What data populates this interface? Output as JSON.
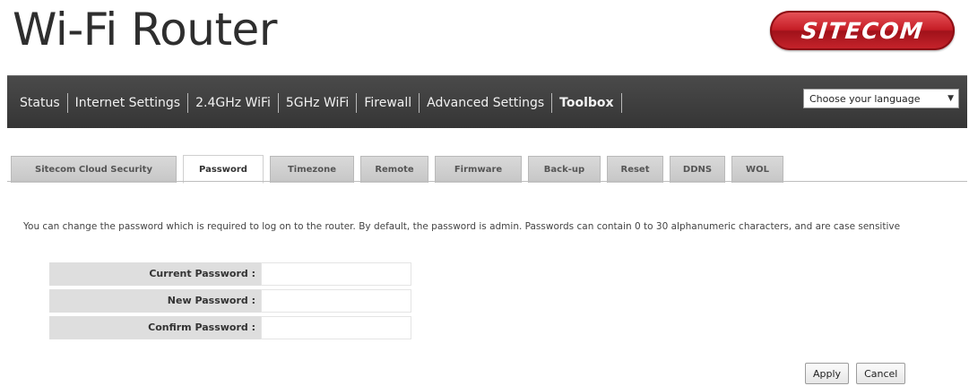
{
  "header": {
    "title": "Wi-Fi Router",
    "logo_text": "SITECOM"
  },
  "nav": {
    "items": [
      {
        "label": "Status"
      },
      {
        "label": "Internet Settings"
      },
      {
        "label": "2.4GHz WiFi"
      },
      {
        "label": "5GHz WiFi"
      },
      {
        "label": "Firewall"
      },
      {
        "label": "Advanced Settings"
      },
      {
        "label": "Toolbox",
        "active": true
      }
    ],
    "language_select": "Choose your language"
  },
  "tabs": [
    {
      "label": "Sitecom Cloud Security"
    },
    {
      "label": "Password",
      "active": true
    },
    {
      "label": "Timezone"
    },
    {
      "label": "Remote"
    },
    {
      "label": "Firmware"
    },
    {
      "label": "Back-up"
    },
    {
      "label": "Reset"
    },
    {
      "label": "DDNS"
    },
    {
      "label": "WOL"
    }
  ],
  "description": "You can change the password which is required to log on to the router. By default, the password is admin. Passwords can contain 0 to 30 alphanumeric characters, and are case sensitive",
  "form": {
    "current_password_label": "Current Password :",
    "current_password_value": "",
    "new_password_label": "New Password :",
    "new_password_value": "",
    "confirm_password_label": "Confirm Password :",
    "confirm_password_value": ""
  },
  "buttons": {
    "apply": "Apply",
    "cancel": "Cancel"
  },
  "colors": {
    "brand_red": "#c61d26",
    "navbar": "#3c3c3c",
    "tab_inactive": "#cfcfcf"
  }
}
